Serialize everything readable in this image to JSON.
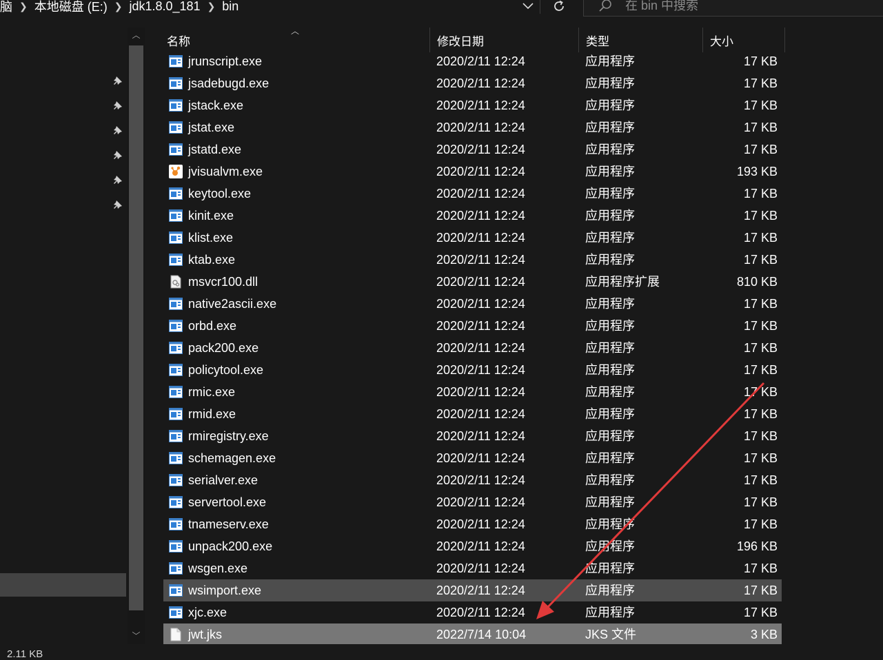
{
  "address_bar": {
    "crumbs": [
      "本地磁盘 (E:)",
      "jdk1.8.0_181",
      "bin"
    ],
    "left_fragment": "脑"
  },
  "search": {
    "placeholder": "在 bin 中搜索"
  },
  "columns": {
    "name": "名称",
    "date": "修改日期",
    "type": "类型",
    "size": "大小"
  },
  "files": [
    {
      "name": "jrunscript.exe",
      "date": "2020/2/11 12:24",
      "type": "应用程序",
      "size": "17 KB",
      "icon": "exe-icon"
    },
    {
      "name": "jsadebugd.exe",
      "date": "2020/2/11 12:24",
      "type": "应用程序",
      "size": "17 KB",
      "icon": "exe-icon"
    },
    {
      "name": "jstack.exe",
      "date": "2020/2/11 12:24",
      "type": "应用程序",
      "size": "17 KB",
      "icon": "exe-icon"
    },
    {
      "name": "jstat.exe",
      "date": "2020/2/11 12:24",
      "type": "应用程序",
      "size": "17 KB",
      "icon": "exe-icon"
    },
    {
      "name": "jstatd.exe",
      "date": "2020/2/11 12:24",
      "type": "应用程序",
      "size": "17 KB",
      "icon": "exe-icon"
    },
    {
      "name": "jvisualvm.exe",
      "date": "2020/2/11 12:24",
      "type": "应用程序",
      "size": "193 KB",
      "icon": "visualvm-icon"
    },
    {
      "name": "keytool.exe",
      "date": "2020/2/11 12:24",
      "type": "应用程序",
      "size": "17 KB",
      "icon": "exe-icon"
    },
    {
      "name": "kinit.exe",
      "date": "2020/2/11 12:24",
      "type": "应用程序",
      "size": "17 KB",
      "icon": "exe-icon"
    },
    {
      "name": "klist.exe",
      "date": "2020/2/11 12:24",
      "type": "应用程序",
      "size": "17 KB",
      "icon": "exe-icon"
    },
    {
      "name": "ktab.exe",
      "date": "2020/2/11 12:24",
      "type": "应用程序",
      "size": "17 KB",
      "icon": "exe-icon"
    },
    {
      "name": "msvcr100.dll",
      "date": "2020/2/11 12:24",
      "type": "应用程序扩展",
      "size": "810 KB",
      "icon": "dll-icon"
    },
    {
      "name": "native2ascii.exe",
      "date": "2020/2/11 12:24",
      "type": "应用程序",
      "size": "17 KB",
      "icon": "exe-icon"
    },
    {
      "name": "orbd.exe",
      "date": "2020/2/11 12:24",
      "type": "应用程序",
      "size": "17 KB",
      "icon": "exe-icon"
    },
    {
      "name": "pack200.exe",
      "date": "2020/2/11 12:24",
      "type": "应用程序",
      "size": "17 KB",
      "icon": "exe-icon"
    },
    {
      "name": "policytool.exe",
      "date": "2020/2/11 12:24",
      "type": "应用程序",
      "size": "17 KB",
      "icon": "exe-icon"
    },
    {
      "name": "rmic.exe",
      "date": "2020/2/11 12:24",
      "type": "应用程序",
      "size": "17 KB",
      "icon": "exe-icon"
    },
    {
      "name": "rmid.exe",
      "date": "2020/2/11 12:24",
      "type": "应用程序",
      "size": "17 KB",
      "icon": "exe-icon"
    },
    {
      "name": "rmiregistry.exe",
      "date": "2020/2/11 12:24",
      "type": "应用程序",
      "size": "17 KB",
      "icon": "exe-icon"
    },
    {
      "name": "schemagen.exe",
      "date": "2020/2/11 12:24",
      "type": "应用程序",
      "size": "17 KB",
      "icon": "exe-icon"
    },
    {
      "name": "serialver.exe",
      "date": "2020/2/11 12:24",
      "type": "应用程序",
      "size": "17 KB",
      "icon": "exe-icon"
    },
    {
      "name": "servertool.exe",
      "date": "2020/2/11 12:24",
      "type": "应用程序",
      "size": "17 KB",
      "icon": "exe-icon"
    },
    {
      "name": "tnameserv.exe",
      "date": "2020/2/11 12:24",
      "type": "应用程序",
      "size": "17 KB",
      "icon": "exe-icon"
    },
    {
      "name": "unpack200.exe",
      "date": "2020/2/11 12:24",
      "type": "应用程序",
      "size": "196 KB",
      "icon": "exe-icon"
    },
    {
      "name": "wsgen.exe",
      "date": "2020/2/11 12:24",
      "type": "应用程序",
      "size": "17 KB",
      "icon": "exe-icon"
    },
    {
      "name": "wsimport.exe",
      "date": "2020/2/11 12:24",
      "type": "应用程序",
      "size": "17 KB",
      "icon": "exe-icon",
      "state": "hover"
    },
    {
      "name": "xjc.exe",
      "date": "2020/2/11 12:24",
      "type": "应用程序",
      "size": "17 KB",
      "icon": "exe-icon"
    },
    {
      "name": "jwt.jks",
      "date": "2022/7/14 10:04",
      "type": "JKS 文件",
      "size": "3 KB",
      "icon": "file-icon",
      "state": "selected"
    }
  ],
  "status": {
    "text": "2.11 KB"
  },
  "colors": {
    "background": "#191919",
    "selected_row": "#777777",
    "hover_row": "#4d4d4d",
    "annotation_arrow": "#e03a3a",
    "exe_icon_blue": "#2f7fd6"
  }
}
